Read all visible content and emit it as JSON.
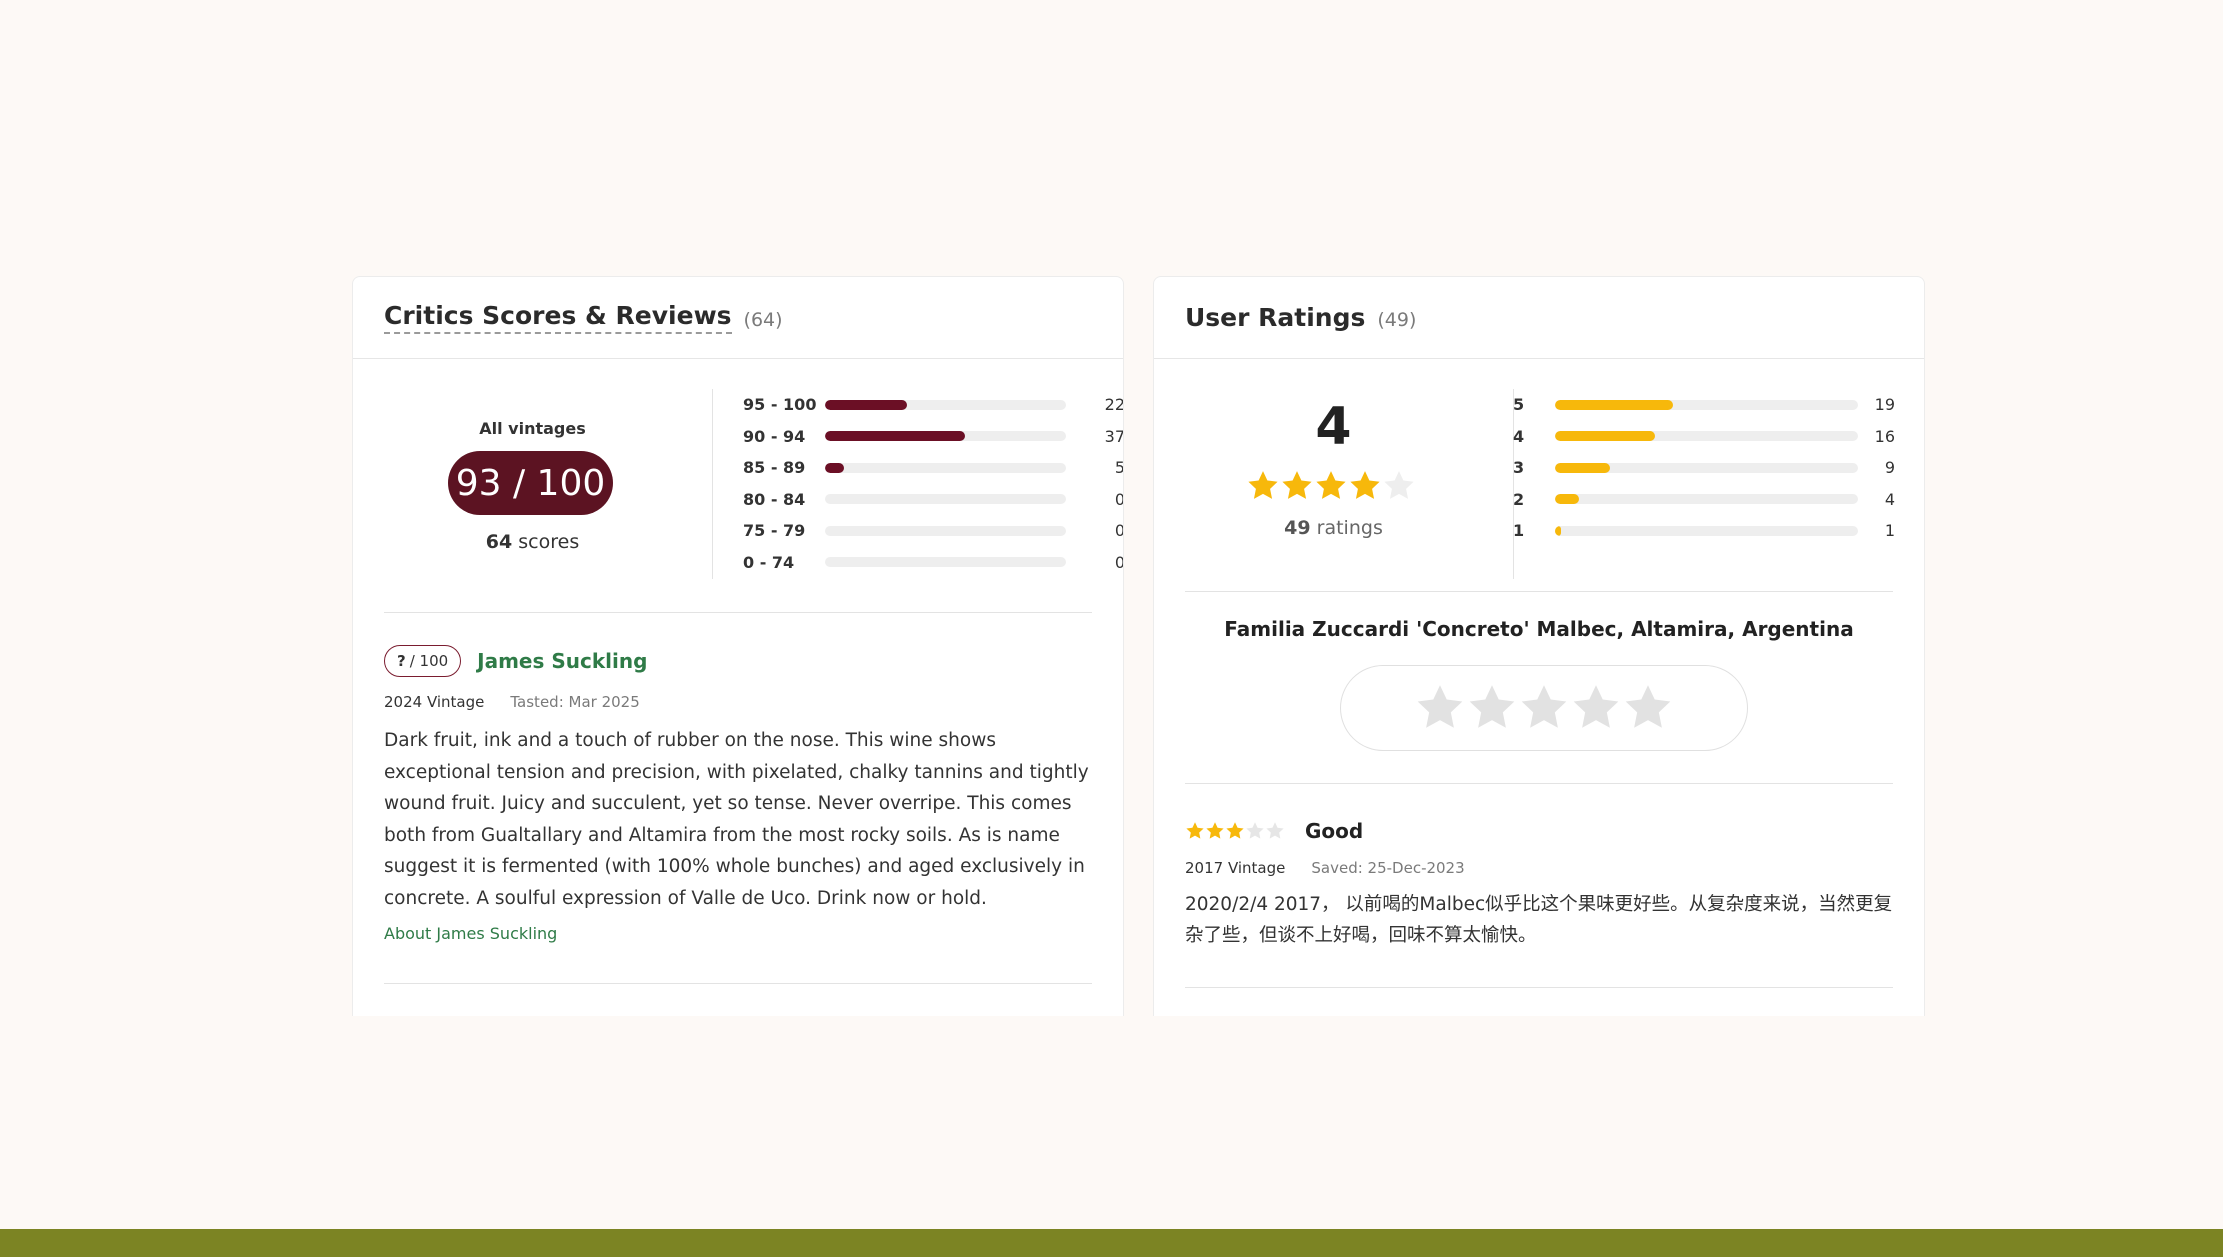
{
  "colors": {
    "background": "#fdf9f6",
    "critic_accent": "#5c1322",
    "critic_bar": "#6b0f25",
    "user_bar": "#f7b80b",
    "link_green": "#2f7b47",
    "footer_bar": "#7c8423"
  },
  "critics": {
    "title": "Critics Scores & Reviews",
    "count": "(64)",
    "all_vintages_label": "All vintages",
    "score": "93 / 100",
    "scores_count_num": "64",
    "scores_count_word": "scores",
    "distribution": [
      {
        "label": "95 - 100",
        "value": "22",
        "fraction": 0.34
      },
      {
        "label": "90 - 94",
        "value": "37",
        "fraction": 0.58
      },
      {
        "label": "85 - 89",
        "value": "5",
        "fraction": 0.08
      },
      {
        "label": "80 - 84",
        "value": "0",
        "fraction": 0
      },
      {
        "label": "75 - 79",
        "value": "0",
        "fraction": 0
      },
      {
        "label": "0 - 74",
        "value": "0",
        "fraction": 0
      }
    ],
    "review": {
      "score_value": "?",
      "score_suffix": "/ 100",
      "critic_name": "James Suckling",
      "vintage": "2024 Vintage",
      "tasted": "Tasted: Mar 2025",
      "text": "Dark fruit, ink and a touch of rubber on the nose. This wine shows exceptional tension and precision, with pixelated, chalky tannins and tightly wound fruit. Juicy and succulent, yet so tense. Never overripe. This comes both from Gualtallary and Altamira from the most rocky soils. As is name suggest it is fermented (with 100% whole bunches) and aged exclusively in concrete. A soulful expression of Valle de Uco. Drink now or hold.",
      "about_link": "About James Suckling"
    }
  },
  "users": {
    "title": "User Ratings",
    "count": "(49)",
    "average": "4",
    "average_stars": 4,
    "ratings_count_num": "49",
    "ratings_count_word": "ratings",
    "distribution": [
      {
        "label": "5",
        "value": "19",
        "fraction": 0.39
      },
      {
        "label": "4",
        "value": "16",
        "fraction": 0.33
      },
      {
        "label": "3",
        "value": "9",
        "fraction": 0.18
      },
      {
        "label": "2",
        "value": "4",
        "fraction": 0.08
      },
      {
        "label": "1",
        "value": "1",
        "fraction": 0.02
      }
    ],
    "wine_name": "Familia Zuccardi 'Concreto' Malbec, Altamira, Argentina",
    "rate_stars": 5,
    "review": {
      "stars": 3,
      "title": "Good",
      "vintage": "2017 Vintage",
      "saved": "Saved: 25-Dec-2023",
      "text": "2020/2/4 2017， 以前喝的Malbec似乎比这个果味更好些。从复杂度来说，当然更复杂了些，但谈不上好喝，回味不算太愉快。"
    }
  }
}
